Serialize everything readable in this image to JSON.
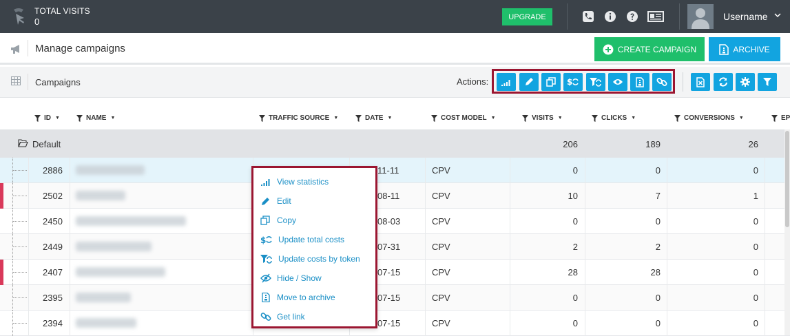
{
  "topbar": {
    "total_visits_label": "TOTAL VISITS",
    "total_visits_value": "0",
    "upgrade_label": "UPGRADE",
    "username": "Username"
  },
  "subheader": {
    "title": "Manage campaigns",
    "create_label": "CREATE CAMPAIGN",
    "archive_label": "ARCHIVE"
  },
  "toolbar": {
    "label": "Campaigns",
    "actions_label": "Actions:",
    "action_icons": [
      "statistics-icon",
      "edit-icon",
      "copy-icon",
      "update-costs-icon",
      "update-costs-by-token-icon",
      "hide-show-icon",
      "archive-icon",
      "link-icon"
    ],
    "extra_icons": [
      "export-excel-icon",
      "refresh-icon",
      "settings-icon",
      "filter-icon"
    ]
  },
  "table": {
    "headers": [
      "ID",
      "NAME",
      "TRAFFIC SOURCE",
      "DATE",
      "COST MODEL",
      "VISITS",
      "CLICKS",
      "CONVERSIONS",
      "EP"
    ],
    "group": {
      "name": "Default",
      "visits": "206",
      "clicks": "189",
      "conversions": "26"
    },
    "rows": [
      {
        "id": "2886",
        "date": "11-11",
        "cost_model": "CPV",
        "visits": "0",
        "clicks": "0",
        "conversions": "0",
        "marked": false,
        "highlight": true
      },
      {
        "id": "2502",
        "date": "08-11",
        "cost_model": "CPV",
        "visits": "10",
        "clicks": "7",
        "conversions": "1",
        "marked": true,
        "highlight": false
      },
      {
        "id": "2450",
        "date": "08-03",
        "cost_model": "CPV",
        "visits": "0",
        "clicks": "0",
        "conversions": "0",
        "marked": false,
        "highlight": false
      },
      {
        "id": "2449",
        "date": "07-31",
        "cost_model": "CPV",
        "visits": "2",
        "clicks": "2",
        "conversions": "0",
        "marked": false,
        "highlight": false
      },
      {
        "id": "2407",
        "date": "07-15",
        "cost_model": "CPV",
        "visits": "28",
        "clicks": "28",
        "conversions": "0",
        "marked": true,
        "highlight": false
      },
      {
        "id": "2395",
        "date": "07-15",
        "cost_model": "CPV",
        "visits": "0",
        "clicks": "0",
        "conversions": "0",
        "marked": false,
        "highlight": false
      },
      {
        "id": "2394",
        "date": "07-15",
        "cost_model": "CPV",
        "visits": "0",
        "clicks": "0",
        "conversions": "0",
        "marked": false,
        "highlight": false
      }
    ]
  },
  "context_menu": {
    "items": [
      {
        "label": "View statistics",
        "icon": "statistics-icon"
      },
      {
        "label": "Edit",
        "icon": "edit-icon"
      },
      {
        "label": "Copy",
        "icon": "copy-icon"
      },
      {
        "label": "Update total costs",
        "icon": "update-costs-icon"
      },
      {
        "label": "Update costs by token",
        "icon": "update-costs-by-token-icon"
      },
      {
        "label": "Hide / Show",
        "icon": "hide-show-icon"
      },
      {
        "label": "Move to archive",
        "icon": "archive-icon"
      },
      {
        "label": "Get link",
        "icon": "link-icon"
      }
    ]
  },
  "colors": {
    "accent": "#12a4e0",
    "success": "#1fbf6b",
    "highlight_border": "#9b1631",
    "marker": "#d9395a"
  }
}
